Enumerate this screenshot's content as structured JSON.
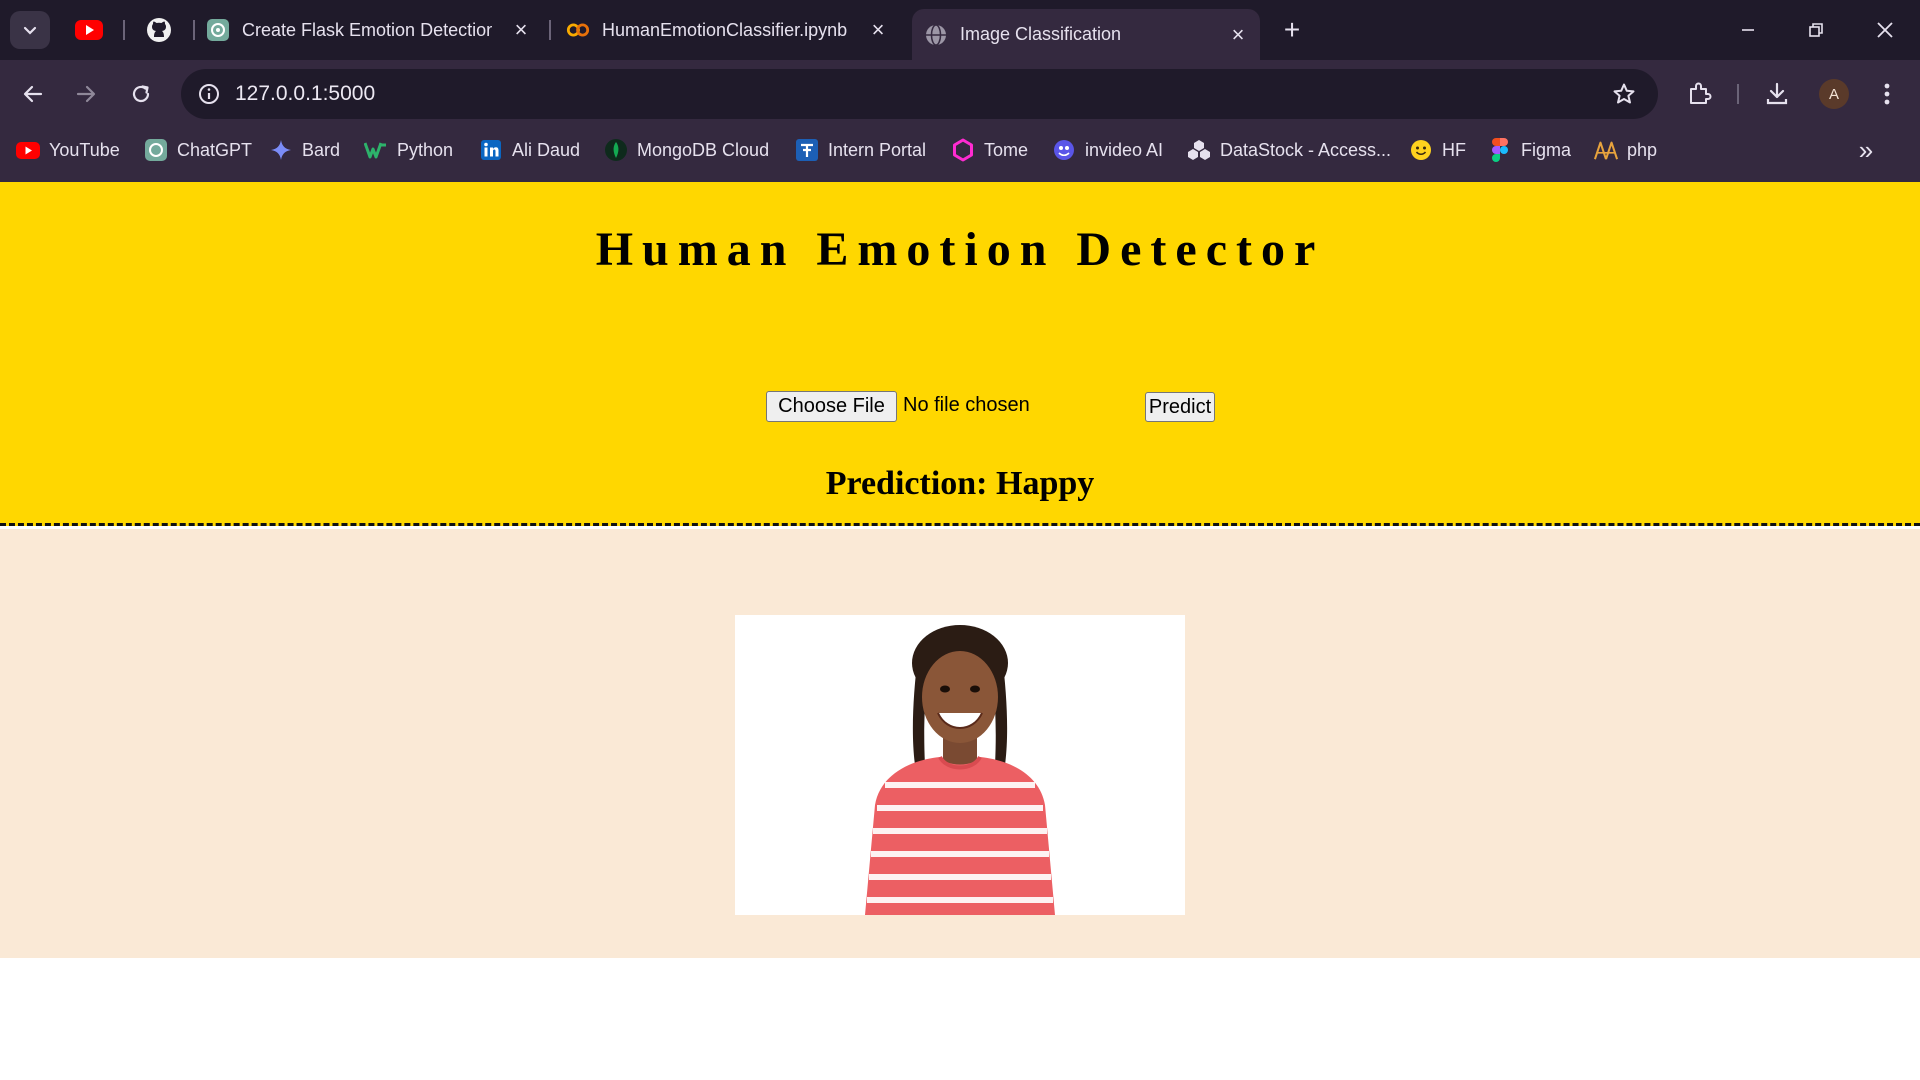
{
  "browser": {
    "tabs": [
      {
        "title": "Create Flask Emotion Detection",
        "icon": "chatgpt-icon",
        "active": false
      },
      {
        "title": "HumanEmotionClassifier.ipynb",
        "icon": "colab-icon",
        "active": false
      },
      {
        "title": "Image Classification",
        "icon": "globe-icon",
        "active": true
      }
    ],
    "url": "127.0.0.1:5000",
    "profile_initial": "A",
    "bookmarks": [
      {
        "label": "YouTube",
        "icon": "youtube-icon"
      },
      {
        "label": "ChatGPT",
        "icon": "chatgpt-icon"
      },
      {
        "label": "Bard",
        "icon": "bard-icon"
      },
      {
        "label": "Python",
        "icon": "python-icon"
      },
      {
        "label": "Ali Daud",
        "icon": "linkedin-icon"
      },
      {
        "label": "MongoDB Cloud",
        "icon": "mongodb-icon"
      },
      {
        "label": "Intern Portal",
        "icon": "portal-icon"
      },
      {
        "label": "Tome",
        "icon": "tome-icon"
      },
      {
        "label": "invideo AI",
        "icon": "invideo-icon"
      },
      {
        "label": "DataStock - Access...",
        "icon": "datastock-icon"
      },
      {
        "label": "HF",
        "icon": "huggingface-icon"
      },
      {
        "label": "Figma",
        "icon": "figma-icon"
      },
      {
        "label": "php",
        "icon": "php-icon"
      }
    ]
  },
  "app": {
    "title": "Human Emotion Detector",
    "choose_file_label": "Choose File",
    "file_status": "No file chosen",
    "predict_label": "Predict",
    "prediction_label": "Prediction:",
    "prediction_value": "Happy",
    "image_subject": "smiling girl in striped shirt"
  },
  "colors": {
    "header_bg": "#ffd700",
    "content_bg": "#fae9d6",
    "chrome_bg": "#34293f",
    "tabstrip_bg": "#1f1a2a"
  }
}
